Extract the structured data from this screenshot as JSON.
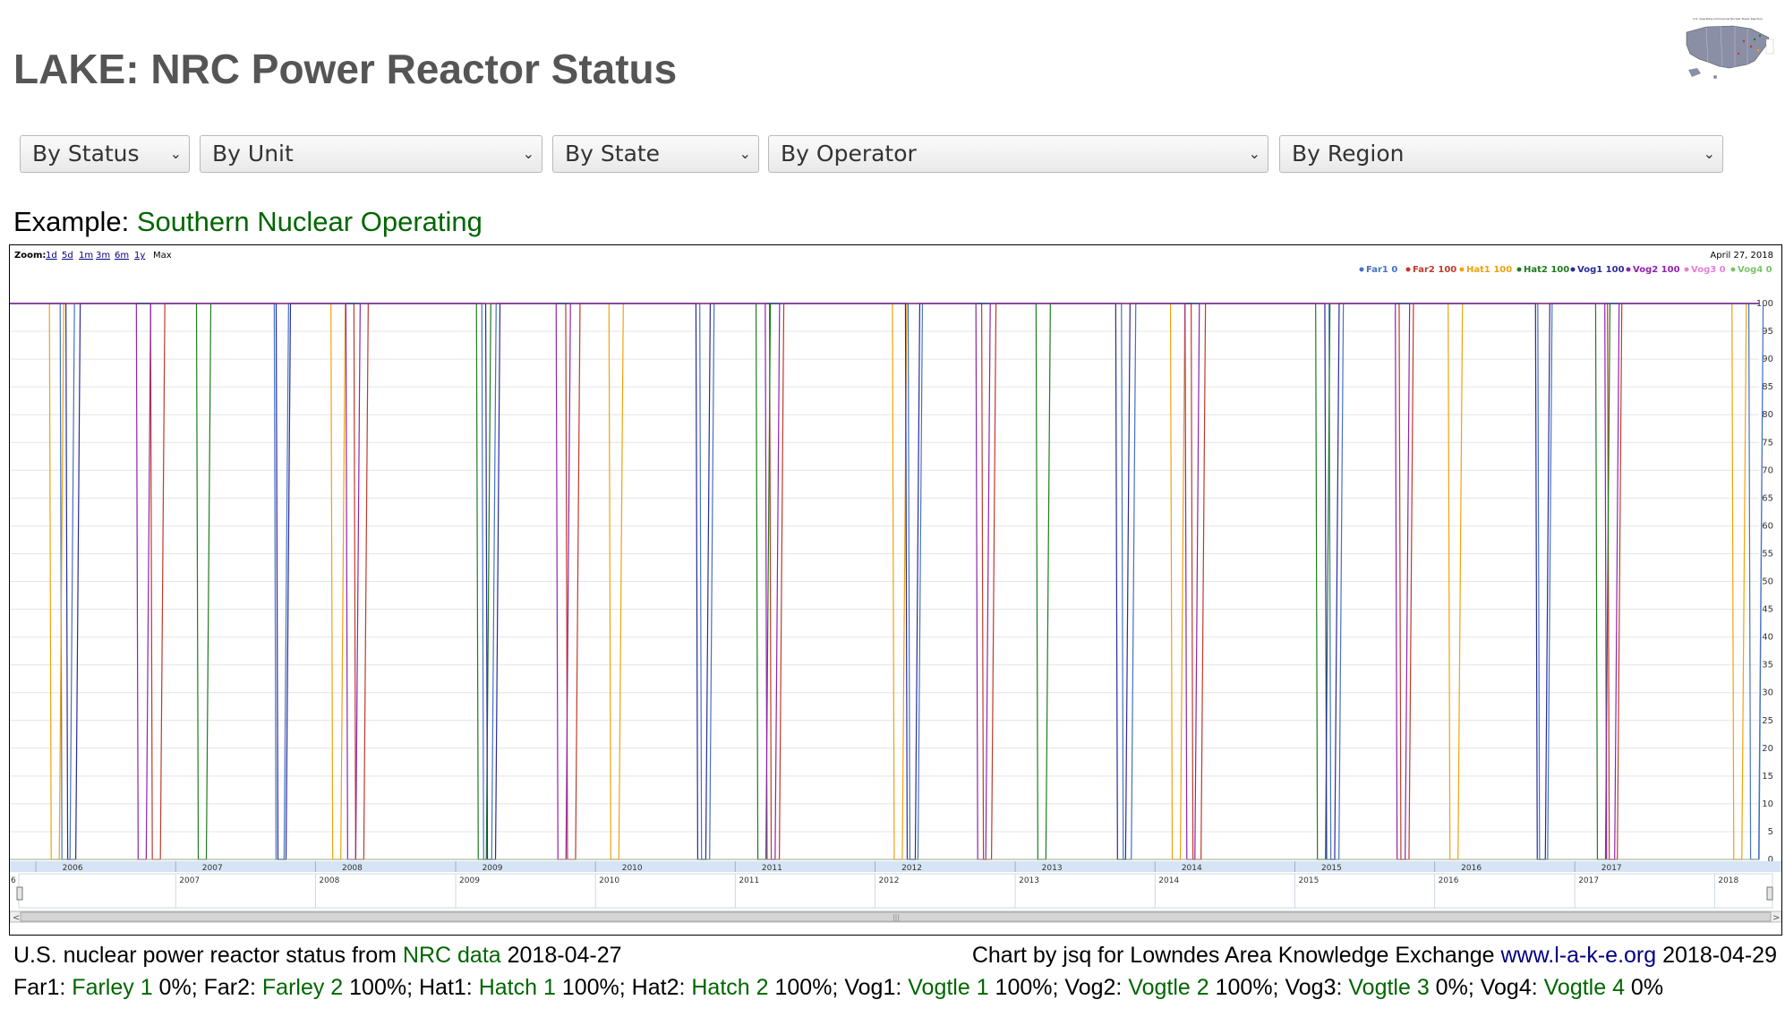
{
  "page": {
    "title": "LAKE: NRC Power Reactor Status",
    "map_thumbnail_caption": "U.S. Operating Commercial Nuclear Power Reactors"
  },
  "filters": [
    {
      "label": "By Status"
    },
    {
      "label": "By Unit"
    },
    {
      "label": "By State"
    },
    {
      "label": "By Operator"
    },
    {
      "label": "By Region"
    }
  ],
  "example": {
    "prefix": "Example:",
    "link": "Southern Nuclear Operating"
  },
  "chart": {
    "zoom_label": "Zoom:",
    "zoom_options": [
      "1d",
      "5d",
      "1m",
      "3m",
      "6m",
      "1y",
      "Max"
    ],
    "date_label": "April 27, 2018"
  },
  "chart_data": {
    "type": "line",
    "title": "",
    "xlabel": "",
    "ylabel": "",
    "ylim": [
      0,
      100
    ],
    "yticks": [
      0,
      5,
      10,
      15,
      20,
      25,
      30,
      35,
      40,
      45,
      50,
      55,
      60,
      65,
      70,
      75,
      80,
      85,
      90,
      95,
      100
    ],
    "x_range": [
      "2005-10-25",
      "2018-04-27"
    ],
    "year_ticks": [
      "2006",
      "2007",
      "2008",
      "2009",
      "2010",
      "2011",
      "2012",
      "2013",
      "2014",
      "2015",
      "2016",
      "2017"
    ],
    "navigator_ticks": [
      "6",
      "2007",
      "2008",
      "2009",
      "2010",
      "2011",
      "2012",
      "2013",
      "2014",
      "2015",
      "2016",
      "2017",
      "2018"
    ],
    "grid": true,
    "legend_position": "top-right",
    "series": [
      {
        "name": "Far1",
        "latest": 0,
        "color": "#4472c4",
        "outages": [
          [
            "2006-03-10",
            0
          ],
          [
            "2007-09-20",
            0
          ],
          [
            "2009-03-15",
            0
          ],
          [
            "2010-10-05",
            0
          ],
          [
            "2012-04-01",
            0
          ],
          [
            "2013-10-10",
            0
          ],
          [
            "2015-04-05",
            0
          ],
          [
            "2016-10-01",
            0
          ],
          [
            "2018-04-05",
            0
          ]
        ]
      },
      {
        "name": "Far2",
        "latest": 100,
        "color": "#c0392b",
        "outages": [
          [
            "2006-11-01",
            0
          ],
          [
            "2008-04-15",
            0
          ],
          [
            "2009-10-20",
            0
          ],
          [
            "2011-04-05",
            0
          ],
          [
            "2012-10-10",
            0
          ],
          [
            "2014-04-10",
            0
          ],
          [
            "2015-10-05",
            0
          ],
          [
            "2017-04-01",
            0
          ]
        ]
      },
      {
        "name": "Hat1",
        "latest": 100,
        "color": "#f0a30a",
        "outages": [
          [
            "2006-02-10",
            0
          ],
          [
            "2008-02-15",
            0
          ],
          [
            "2010-02-10",
            0
          ],
          [
            "2012-02-20",
            0
          ],
          [
            "2014-02-15",
            0
          ],
          [
            "2016-02-10",
            0
          ],
          [
            "2018-02-20",
            0
          ]
        ]
      },
      {
        "name": "Hat2",
        "latest": 100,
        "color": "#1e7b1e",
        "outages": [
          [
            "2007-03-01",
            0
          ],
          [
            "2009-03-01",
            0
          ],
          [
            "2011-03-01",
            0
          ],
          [
            "2013-03-01",
            0
          ],
          [
            "2015-03-01",
            0
          ],
          [
            "2017-03-01",
            0
          ]
        ]
      },
      {
        "name": "Vog1",
        "latest": 100,
        "color": "#2a2a9a",
        "outages": [
          [
            "2006-03-25",
            0
          ],
          [
            "2007-09-25",
            0
          ],
          [
            "2009-03-25",
            0
          ],
          [
            "2010-09-25",
            0
          ],
          [
            "2012-03-25",
            0
          ],
          [
            "2013-09-25",
            0
          ],
          [
            "2015-03-25",
            0
          ],
          [
            "2016-09-25",
            0
          ]
        ]
      },
      {
        "name": "Vog2",
        "latest": 100,
        "color": "#8e24aa",
        "outages": [
          [
            "2006-09-25",
            0
          ],
          [
            "2008-03-25",
            0
          ],
          [
            "2009-09-25",
            0
          ],
          [
            "2011-03-25",
            0
          ],
          [
            "2012-09-25",
            0
          ],
          [
            "2014-03-25",
            0
          ],
          [
            "2015-09-25",
            0
          ],
          [
            "2017-03-25",
            0
          ]
        ]
      },
      {
        "name": "Vog3",
        "latest": 0,
        "color": "#e67fdb",
        "outages": []
      },
      {
        "name": "Vog4",
        "latest": 0,
        "color": "#7cc36a",
        "outages": []
      }
    ]
  },
  "footer": {
    "source_prefix": "U.S. nuclear power reactor status from",
    "source_link": "NRC data",
    "source_date": "2018-04-27",
    "credit_prefix": "Chart by jsq for Lowndes Area Knowledge Exchange",
    "credit_link": "www.l-a-k-e.org",
    "credit_date": "2018-04-29",
    "units": [
      {
        "code": "Far1:",
        "name": "Farley 1",
        "pct": "0%;"
      },
      {
        "code": "Far2:",
        "name": "Farley 2",
        "pct": "100%;"
      },
      {
        "code": "Hat1:",
        "name": "Hatch 1",
        "pct": "100%;"
      },
      {
        "code": "Hat2:",
        "name": "Hatch 2",
        "pct": "100%;"
      },
      {
        "code": "Vog1:",
        "name": "Vogtle 1",
        "pct": "100%;"
      },
      {
        "code": "Vog2:",
        "name": "Vogtle 2",
        "pct": "100%;"
      },
      {
        "code": "Vog3:",
        "name": "Vogtle 3",
        "pct": "0%;"
      },
      {
        "code": "Vog4:",
        "name": "Vogtle 4",
        "pct": "0%"
      }
    ]
  }
}
